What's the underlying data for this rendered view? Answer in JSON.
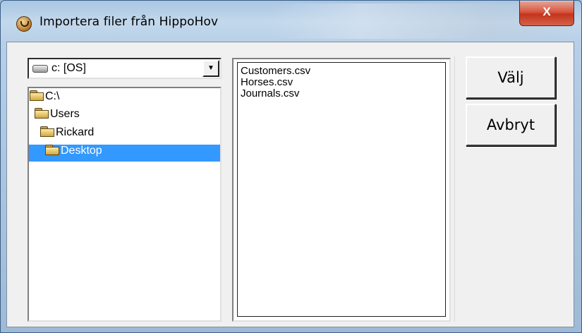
{
  "window": {
    "title": "Importera filer från HippoHov",
    "close_label": "X"
  },
  "drive": {
    "selected": "c: [OS]",
    "dropdown_arrow": "▼"
  },
  "tree": {
    "items": [
      {
        "label": "C:\\"
      },
      {
        "label": "Users"
      },
      {
        "label": "Rickard"
      },
      {
        "label": "Desktop"
      }
    ],
    "selected_index": 3
  },
  "files": {
    "items": [
      "Customers.csv",
      "Horses.csv",
      "Journals.csv"
    ]
  },
  "buttons": {
    "choose_label": "Välj",
    "cancel_label": "Avbryt"
  },
  "colors": {
    "selection": "#3399ff",
    "close_button": "#c4341c"
  }
}
